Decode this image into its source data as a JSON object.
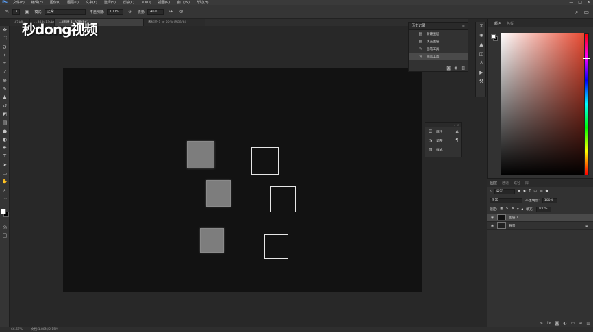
{
  "app": {
    "logo": "Ps"
  },
  "menu": [
    "文件(F)",
    "编辑(E)",
    "图像(I)",
    "图层(L)",
    "文字(Y)",
    "选择(S)",
    "滤镜(T)",
    "3D(D)",
    "视图(V)",
    "窗口(W)",
    "帮助(H)"
  ],
  "window_controls": [
    "—",
    "□",
    "✕"
  ],
  "options": {
    "brush_size": "3",
    "mode_label": "模式:",
    "mode_value": "正常",
    "opacity_label": "不透明度:",
    "opacity_value": "100%",
    "flow_label": "流量:",
    "flow_value": "46%"
  },
  "tabs": [
    {
      "label": "df1b8…",
      "active": false
    },
    {
      "label": "…345d13cbe",
      "active": false
    },
    {
      "label": "…(图层 1, RGB/8#) *",
      "active": true
    },
    {
      "label": "未标题-1 @ 50% (RGB/8) *",
      "active": false
    }
  ],
  "watermark": "秒dong视频",
  "status": {
    "zoom": "66.67%",
    "doc": "文档:1.88M/2.15M"
  },
  "history": {
    "title": "历史记录",
    "items": [
      {
        "label": "新建图层",
        "icon": "layer-icon",
        "selected": false
      },
      {
        "label": "填充图层",
        "icon": "layer-icon",
        "selected": false
      },
      {
        "label": "画笔工具",
        "icon": "brush-icon",
        "selected": false
      },
      {
        "label": "画笔工具",
        "icon": "brush-icon",
        "selected": true
      }
    ]
  },
  "mini_panel": {
    "items": [
      "属性",
      "调整",
      "样式"
    ]
  },
  "color_panel": {
    "tab_color": "颜色",
    "tab_swatches": "色板",
    "hue_color": "#e8452c"
  },
  "layers_panel": {
    "tabs": [
      "图层",
      "通道",
      "路径",
      "库"
    ],
    "filter_label": "类型",
    "blend_mode": "正常",
    "opacity_label": "不透明度:",
    "opacity_value": "100%",
    "lock_label": "锁定:",
    "fill_label": "填充:",
    "fill_value": "100%",
    "layers": [
      {
        "name": "图层 1",
        "selected": true
      },
      {
        "name": "背景",
        "selected": false
      }
    ]
  }
}
